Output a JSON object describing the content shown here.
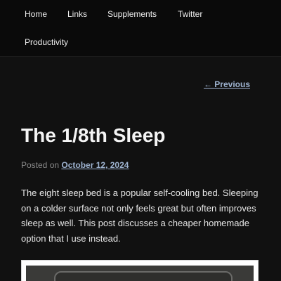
{
  "nav": {
    "items": [
      {
        "label": "Home"
      },
      {
        "label": "Links"
      },
      {
        "label": "Supplements"
      },
      {
        "label": "Twitter"
      },
      {
        "label": "Productivity"
      }
    ]
  },
  "post_nav": {
    "previous_label": "← Previous"
  },
  "post": {
    "title": "The 1/8th Sleep",
    "posted_on_label": "Posted on ",
    "date": "October 12, 2024",
    "intro": "The eight sleep bed is a popular self-cooling bed. Sleeping on a colder surface not only feels great but often improves sleep as well. This post discusses a cheaper homemade option that I use instead."
  },
  "colors": {
    "background": "#111111",
    "link": "#9eb3d0",
    "text": "#e6e6e6"
  }
}
